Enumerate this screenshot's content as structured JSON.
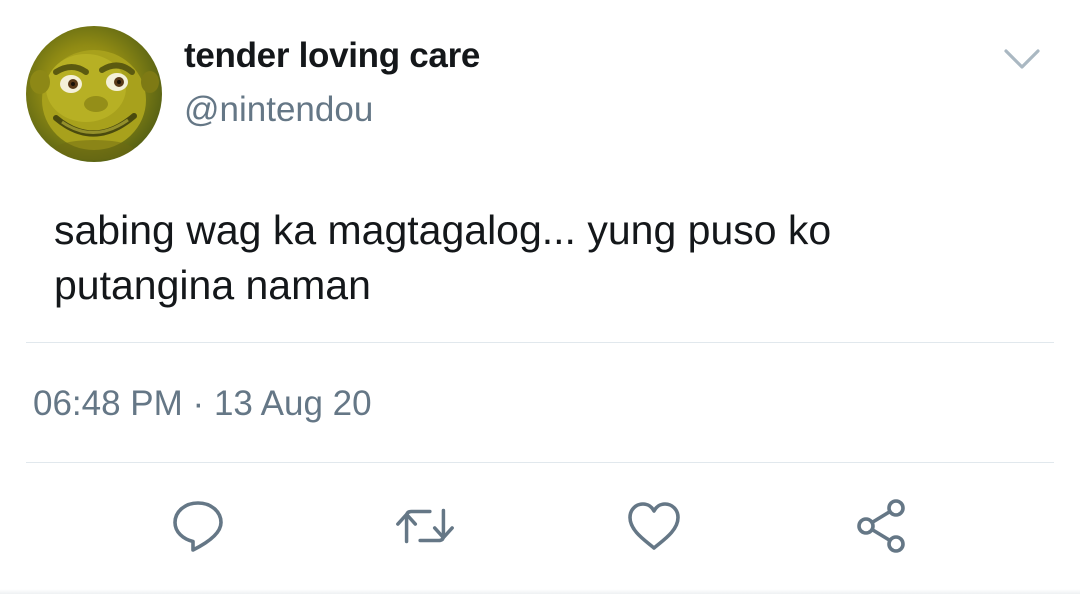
{
  "tweet": {
    "author": {
      "display_name": "tender loving care",
      "handle": "@nintendou",
      "avatar_icon": "avatar"
    },
    "text_lines": [
      "sabing wag ka magtagalog... yung puso ko",
      "putangina naman"
    ],
    "time": "06:48 PM",
    "separator": "·",
    "date": "13 Aug 20"
  },
  "actions": [
    {
      "name": "reply",
      "icon": "reply-icon"
    },
    {
      "name": "retweet",
      "icon": "retweet-icon"
    },
    {
      "name": "like",
      "icon": "heart-icon"
    },
    {
      "name": "share",
      "icon": "share-icon"
    }
  ],
  "colors": {
    "text_primary": "#14171a",
    "text_secondary": "#657786",
    "divider": "#e1e8ed",
    "icon": "#657786"
  }
}
